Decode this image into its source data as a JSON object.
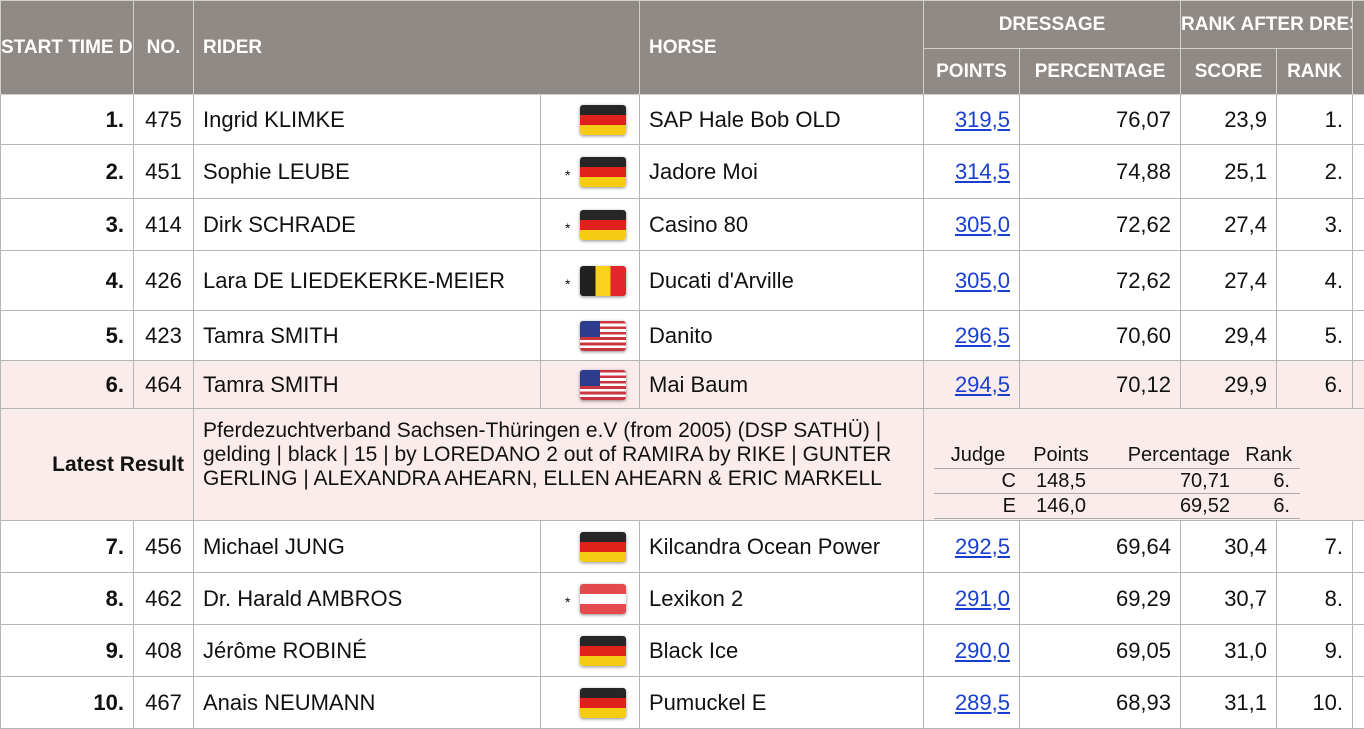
{
  "header": {
    "start_time": "START TIME DRESSAGE/ RANK",
    "no": "NO.",
    "rider": "RIDER",
    "horse": "HORSE",
    "dressage": "DRESSAGE",
    "points": "POINTS",
    "percentage": "PERCENTAGE",
    "rank_after_dressage": "RANK AFTER DRESSAGE",
    "score": "SCORE",
    "rank": "RANK"
  },
  "rows": [
    {
      "rank": "1.",
      "no": "475",
      "rider": "Ingrid KLIMKE",
      "star": "",
      "flag": "flag-de",
      "horse": "SAP Hale Bob OLD",
      "points": "319,5",
      "percentage": "76,07",
      "score": "23,9",
      "rank_after": "1."
    },
    {
      "rank": "2.",
      "no": "451",
      "rider": "Sophie LEUBE",
      "star": "*",
      "flag": "flag-de",
      "horse": "Jadore Moi",
      "points": "314,5",
      "percentage": "74,88",
      "score": "25,1",
      "rank_after": "2."
    },
    {
      "rank": "3.",
      "no": "414",
      "rider": "Dirk SCHRADE",
      "star": "*",
      "flag": "flag-de",
      "horse": "Casino 80",
      "points": "305,0",
      "percentage": "72,62",
      "score": "27,4",
      "rank_after": "3."
    },
    {
      "rank": "4.",
      "no": "426",
      "rider": "Lara DE LIEDEKERKE-MEIER",
      "star": "*",
      "flag": "flag-be",
      "horse": "Ducati d'Arville",
      "points": "305,0",
      "percentage": "72,62",
      "score": "27,4",
      "rank_after": "4."
    },
    {
      "rank": "5.",
      "no": "423",
      "rider": "Tamra SMITH",
      "star": "",
      "flag": "flag-us",
      "horse": "Danito",
      "points": "296,5",
      "percentage": "70,60",
      "score": "29,4",
      "rank_after": "5."
    },
    {
      "rank": "6.",
      "no": "464",
      "rider": "Tamra SMITH",
      "star": "",
      "flag": "flag-us",
      "horse": "Mai Baum",
      "points": "294,5",
      "percentage": "70,12",
      "score": "29,9",
      "rank_after": "6."
    },
    {
      "rank": "7.",
      "no": "456",
      "rider": "Michael JUNG",
      "star": "",
      "flag": "flag-de",
      "horse": "Kilcandra Ocean Power",
      "points": "292,5",
      "percentage": "69,64",
      "score": "30,4",
      "rank_after": "7."
    },
    {
      "rank": "8.",
      "no": "462",
      "rider": "Dr. Harald AMBROS",
      "star": "*",
      "flag": "flag-at",
      "horse": "Lexikon 2",
      "points": "291,0",
      "percentage": "69,29",
      "score": "30,7",
      "rank_after": "8."
    },
    {
      "rank": "9.",
      "no": "408",
      "rider": "Jérôme ROBINÉ",
      "star": "",
      "flag": "flag-de",
      "horse": "Black Ice",
      "points": "290,0",
      "percentage": "69,05",
      "score": "31,0",
      "rank_after": "9."
    },
    {
      "rank": "10.",
      "no": "467",
      "rider": "Anais NEUMANN",
      "star": "",
      "flag": "flag-de",
      "horse": "Pumuckel E",
      "points": "289,5",
      "percentage": "68,93",
      "score": "31,1",
      "rank_after": "10."
    }
  ],
  "latest": {
    "label": "Latest Result",
    "info": "Pferdezuchtverband Sachsen-Thüringen e.V (from 2005) (DSP SATHÜ) | gelding | black | 15 | by LOREDANO 2 out of RAMIRA by RIKE | GUNTER GERLING | ALEXANDRA AHEARN, ELLEN AHEARN & ERIC MARKELL",
    "judges_header": {
      "judge": "Judge",
      "points": "Points",
      "percentage": "Percentage",
      "rank": "Rank"
    },
    "judges": [
      {
        "judge": "C",
        "points": "148,5",
        "percentage": "70,71",
        "rank": "6."
      },
      {
        "judge": "E",
        "points": "146,0",
        "percentage": "69,52",
        "rank": "6."
      }
    ]
  }
}
